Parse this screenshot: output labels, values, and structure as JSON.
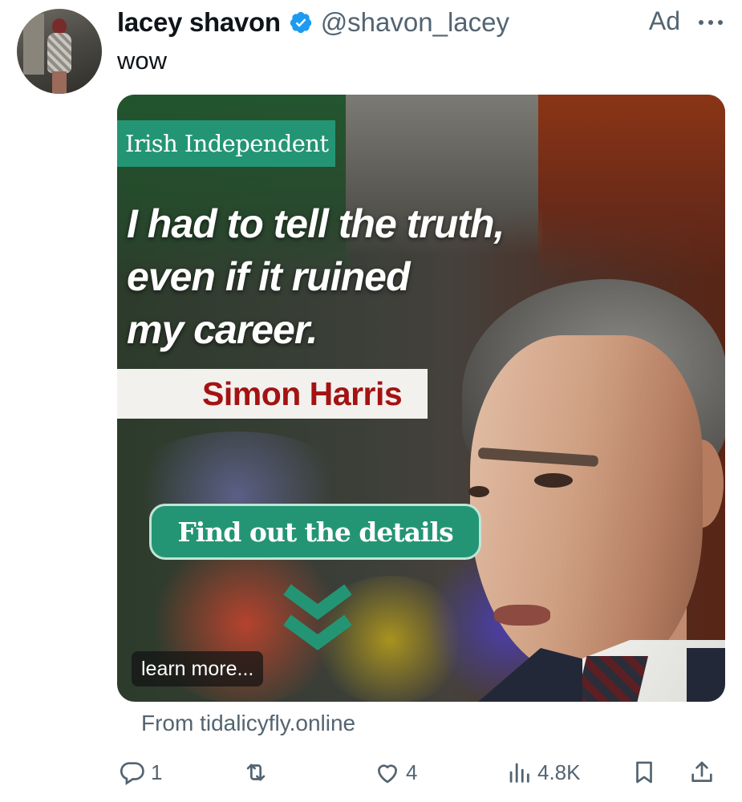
{
  "tweet": {
    "author": {
      "display_name": "lacey shavon",
      "handle": "@shavon_lacey",
      "verified": true,
      "verified_color": "#1d9bf0"
    },
    "ad_label": "Ad",
    "text": "wow",
    "media": {
      "brand": "Irish Independent",
      "headline_lines": [
        "I had to tell the truth,",
        "even if it ruined",
        "my career."
      ],
      "name": "Simon Harris",
      "cta": "Find out the details",
      "learn_more": "learn more...",
      "accent_color": "#249574",
      "name_color": "#a31313"
    },
    "source": "From tidalicyfly.online",
    "actions": {
      "replies": "1",
      "retweets": "",
      "likes": "4",
      "views": "4.8K"
    }
  }
}
